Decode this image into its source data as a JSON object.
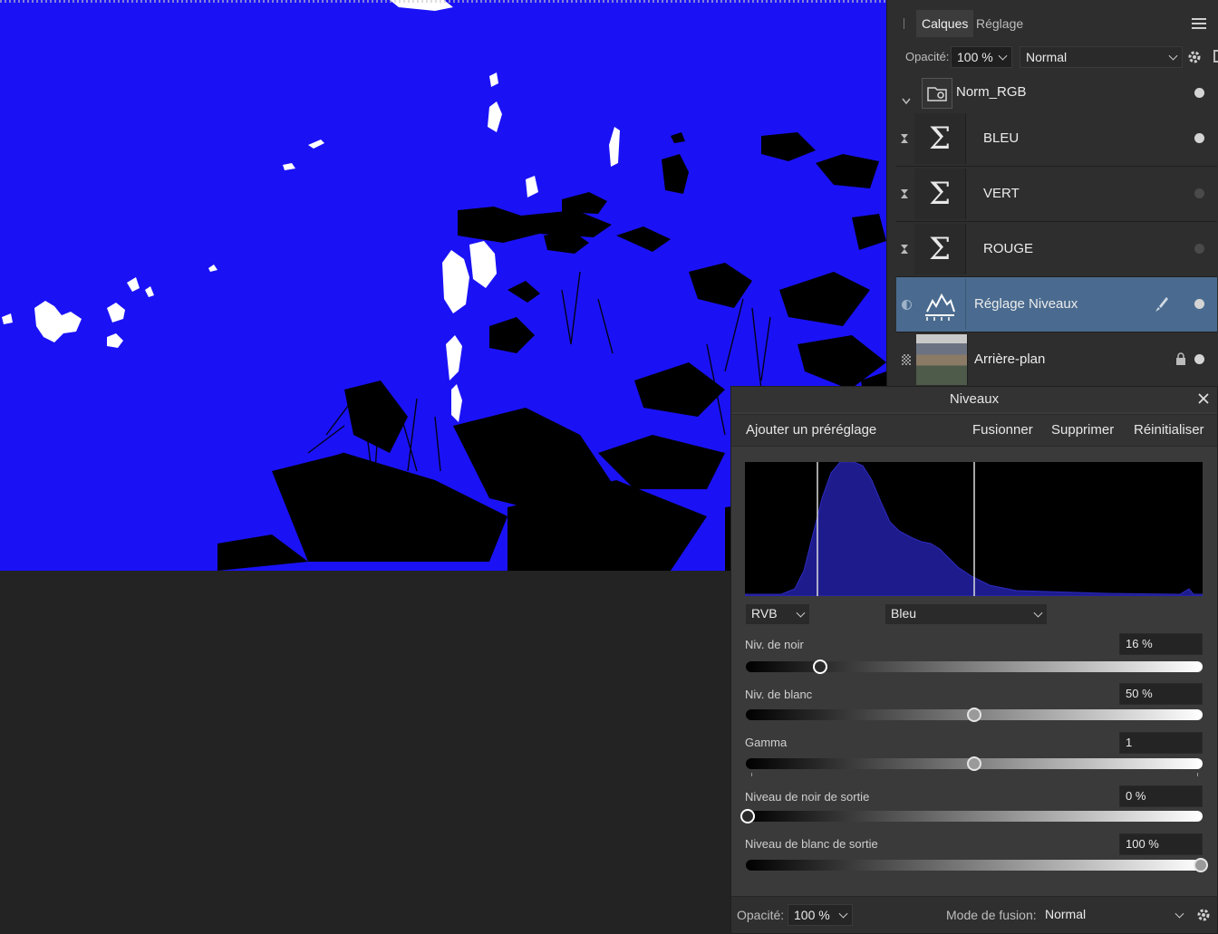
{
  "layers_panel": {
    "tabs": [
      {
        "label": "Calques",
        "active": true
      },
      {
        "label": "Réglage",
        "active": false
      }
    ],
    "opacity_label": "Opacité:",
    "opacity_value": "100 %",
    "blend_mode": "Normal",
    "layers": [
      {
        "name": "Norm_RGB",
        "kind": "group",
        "visible": true
      },
      {
        "name": "BLEU",
        "kind": "formula",
        "visible": true
      },
      {
        "name": "VERT",
        "kind": "formula",
        "visible": false
      },
      {
        "name": "ROUGE",
        "kind": "formula",
        "visible": false
      },
      {
        "name": "Réglage Niveaux",
        "kind": "levels",
        "visible": true,
        "selected": true
      },
      {
        "name": "Arrière-plan",
        "kind": "pixel",
        "visible": true,
        "locked": true
      }
    ]
  },
  "levels_dialog": {
    "title": "Niveaux",
    "actions": {
      "add_preset": "Ajouter un préréglage",
      "merge": "Fusionner",
      "delete": "Supprimer",
      "reset": "Réinitialiser"
    },
    "channel_mode": "RVB",
    "channel": "Bleu",
    "sliders": [
      {
        "label": "Niv. de noir",
        "value": "16 %",
        "level": 0.16
      },
      {
        "label": "Niv. de blanc",
        "value": "50 %",
        "level": 0.5
      },
      {
        "label": "Gamma",
        "value": "1",
        "level": 0.5
      },
      {
        "label": "Niveau de noir de sortie",
        "value": "0 %",
        "level": 0.0
      },
      {
        "label": "Niveau de blanc de sortie",
        "value": "100 %",
        "level": 1.0
      }
    ],
    "footer": {
      "opacity_label": "Opacité:",
      "opacity_value": "100 %",
      "blend_label": "Mode de fusion:",
      "blend_value": "Normal"
    }
  },
  "colors": {
    "canvas_blue": "#1a12f5",
    "selected_row": "#4a6b8f",
    "histogram_fill": "#1e1c8c"
  }
}
